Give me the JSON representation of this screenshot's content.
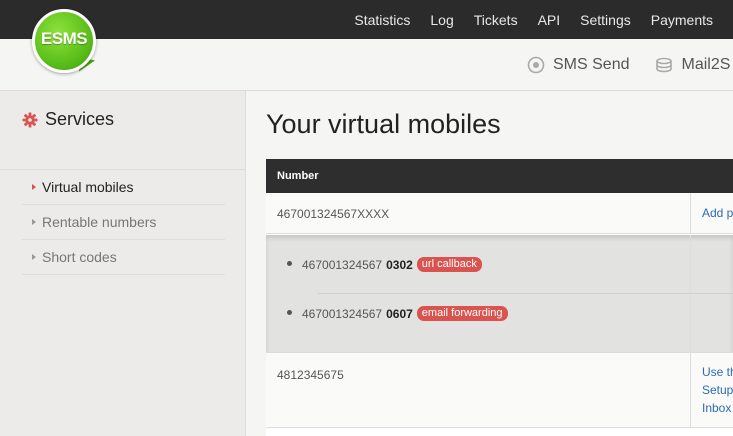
{
  "topnav": [
    "Statistics",
    "Log",
    "Tickets",
    "API",
    "Settings",
    "Payments"
  ],
  "logo": {
    "text": "ESMS"
  },
  "subnav": [
    {
      "label": "SMS Send",
      "icon": "sms-send-icon"
    },
    {
      "label": "Mail2S",
      "icon": "mail2sms-icon"
    }
  ],
  "sidebar": {
    "title": "Services",
    "title_icon": "gear-icon",
    "items": [
      {
        "label": "Virtual mobiles",
        "active": true
      },
      {
        "label": "Rentable numbers",
        "active": false
      },
      {
        "label": "Short codes",
        "active": false
      }
    ]
  },
  "main": {
    "title": "Your virtual mobiles",
    "table": {
      "header": "Number",
      "row1": {
        "number": "467001324567XXXX",
        "action": "Add p"
      },
      "subnumbers": [
        {
          "prefix": "467001324567",
          "suffix": "0302",
          "badge": "url callback"
        },
        {
          "prefix": "467001324567",
          "suffix": "0607",
          "badge": "email forwarding"
        }
      ],
      "row2": {
        "number": "4812345675",
        "actions": [
          "Use th",
          "Setup",
          "Inbox"
        ]
      }
    }
  },
  "colors": {
    "accent": "#d9534f",
    "link": "#2a6db5",
    "topbar": "#2b2b2b",
    "logo_green": "#5bbf1a"
  }
}
